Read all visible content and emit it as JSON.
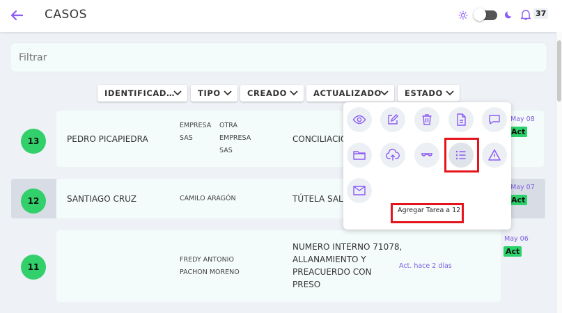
{
  "header": {
    "title": "CASOS",
    "notification_count": "37"
  },
  "filter": {
    "placeholder": "Filtrar"
  },
  "sort_buttons": [
    "IDENTIFICAD…",
    "TIPO",
    "CREADO",
    "ACTUALIZADO",
    "ESTADO"
  ],
  "cases": [
    {
      "number": "13",
      "name": "PEDRO PICAPIEDRA",
      "party_a": [
        "EMPRESA",
        "SAS"
      ],
      "party_b": [
        "OTRA",
        "EMPRESA",
        "SAS"
      ],
      "description": "CONCILIACIÓ",
      "date": "May 08",
      "status": "Act"
    },
    {
      "number": "12",
      "name": "SANTIAGO CRUZ",
      "party_a": [
        "CAMILO ARAGÓN"
      ],
      "description": "TÚTELA SALU",
      "date": "May 07",
      "status": "Act"
    },
    {
      "number": "11",
      "name": "",
      "party_a": [
        "FREDY ANTONIO",
        "PACHON MORENO"
      ],
      "description": [
        "NUMERO INTERNO 71078,",
        "ALLANAMIENTO Y",
        "PREACUERDO CON",
        "PRESO"
      ],
      "updated": "Act. hace 2 días",
      "date": "May 06",
      "status": "Act"
    }
  ],
  "action_menu": {
    "icons": [
      "eye-icon",
      "edit-icon",
      "trash-icon",
      "document-icon",
      "comment-icon",
      "folder-icon",
      "cloud-upload-icon",
      "glasses-icon",
      "list-icon",
      "warning-icon",
      "mail-icon"
    ],
    "tooltip": "Agregar Tarea a 12"
  },
  "colors": {
    "accent": "#8b5cf6",
    "status_green": "#2bd26b",
    "highlight_red": "#e5141c"
  }
}
